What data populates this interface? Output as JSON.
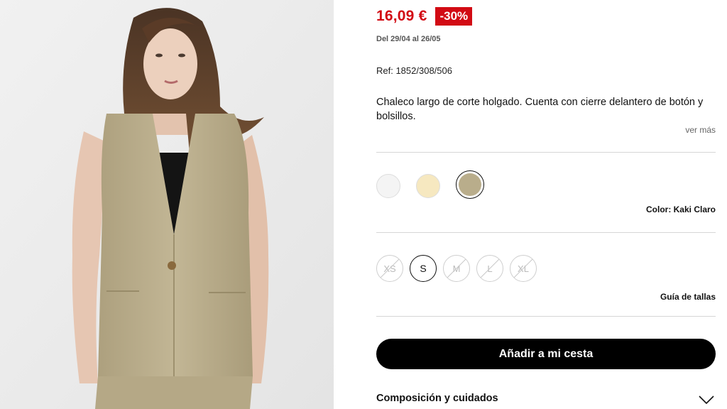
{
  "product": {
    "price": "16,09 €",
    "discount": "-30%",
    "delivery_dates": "Del 29/04 al 26/05",
    "reference": "Ref: 1852/308/506",
    "description": "Chaleco largo de corte holgado. Cuenta con cierre delantero de botón y bolsillos.",
    "see_more": "ver más"
  },
  "colors": {
    "swatches": [
      {
        "name": "white",
        "hex": "#f4f4f4"
      },
      {
        "name": "cream",
        "hex": "#f6e8c0"
      },
      {
        "name": "khaki",
        "hex": "#b9ad8b",
        "selected": true
      }
    ],
    "selected_label": "Color: Kaki Claro"
  },
  "sizes": {
    "options": [
      {
        "label": "XS",
        "available": false
      },
      {
        "label": "S",
        "available": true
      },
      {
        "label": "M",
        "available": false
      },
      {
        "label": "L",
        "available": false
      },
      {
        "label": "XL",
        "available": false
      }
    ],
    "guide_label": "Guía de tallas"
  },
  "actions": {
    "add_to_cart": "Añadir a mi cesta"
  },
  "accordion": {
    "composition_title": "Composición y cuidados"
  },
  "theme": {
    "price_color": "#d20b14",
    "button_color": "#000000",
    "vest_color": "#bdb08f"
  }
}
